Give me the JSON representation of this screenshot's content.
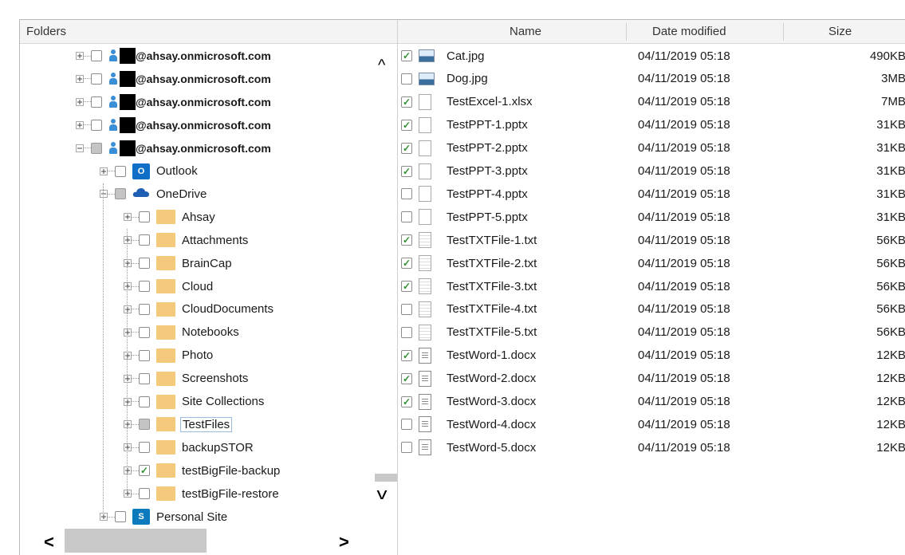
{
  "headers": {
    "folders": "Folders",
    "name": "Name",
    "date_modified": "Date modified",
    "size": "Size"
  },
  "tree": [
    {
      "label": "@ahsay.onmicrosoft.com",
      "type": "user",
      "level": 0,
      "expander": "plus",
      "check": "none"
    },
    {
      "label": "@ahsay.onmicrosoft.com",
      "type": "user",
      "level": 0,
      "expander": "plus",
      "check": "none"
    },
    {
      "label": "@ahsay.onmicrosoft.com",
      "type": "user",
      "level": 0,
      "expander": "plus",
      "check": "none"
    },
    {
      "label": "@ahsay.onmicrosoft.com",
      "type": "user",
      "level": 0,
      "expander": "plus",
      "check": "none"
    },
    {
      "label": "@ahsay.onmicrosoft.com",
      "type": "user",
      "level": 0,
      "expander": "minus",
      "check": "partial"
    },
    {
      "label": "Outlook",
      "type": "outlook",
      "level": 1,
      "expander": "plus",
      "check": "none"
    },
    {
      "label": "OneDrive",
      "type": "onedrive",
      "level": 1,
      "expander": "minus",
      "check": "partial"
    },
    {
      "label": "Ahsay",
      "type": "folder",
      "level": 2,
      "expander": "plus",
      "check": "none"
    },
    {
      "label": "Attachments",
      "type": "folder",
      "level": 2,
      "expander": "plus",
      "check": "none"
    },
    {
      "label": "BrainCap",
      "type": "folder",
      "level": 2,
      "expander": "plus",
      "check": "none"
    },
    {
      "label": "Cloud",
      "type": "folder",
      "level": 2,
      "expander": "plus",
      "check": "none"
    },
    {
      "label": "CloudDocuments",
      "type": "folder",
      "level": 2,
      "expander": "plus",
      "check": "none"
    },
    {
      "label": "Notebooks",
      "type": "folder",
      "level": 2,
      "expander": "plus",
      "check": "none"
    },
    {
      "label": "Photo",
      "type": "folder",
      "level": 2,
      "expander": "plus",
      "check": "none"
    },
    {
      "label": "Screenshots",
      "type": "folder",
      "level": 2,
      "expander": "plus",
      "check": "none"
    },
    {
      "label": "Site Collections",
      "type": "folder",
      "level": 2,
      "expander": "plus",
      "check": "none"
    },
    {
      "label": "TestFiles",
      "type": "folder",
      "level": 2,
      "expander": "plus",
      "check": "partial",
      "selected": true
    },
    {
      "label": "backupSTOR",
      "type": "folder",
      "level": 2,
      "expander": "plus",
      "check": "none"
    },
    {
      "label": "testBigFile-backup",
      "type": "folder",
      "level": 2,
      "expander": "plus",
      "check": "checked"
    },
    {
      "label": "testBigFile-restore",
      "type": "folder",
      "level": 2,
      "expander": "plus",
      "check": "none"
    },
    {
      "label": "Personal Site",
      "type": "sharepoint",
      "level": 1,
      "expander": "plus",
      "check": "none"
    }
  ],
  "icons": {
    "outlook_glyph": "O",
    "sharepoint_glyph": "S",
    "scroll_up": "^",
    "scroll_down": "v",
    "scroll_left": "<",
    "scroll_right": ">",
    "check": "✓"
  },
  "files": [
    {
      "name": "Cat.jpg",
      "date": "04/11/2019 05:18",
      "size": "490KB",
      "checked": true,
      "icon": "image"
    },
    {
      "name": "Dog.jpg",
      "date": "04/11/2019 05:18",
      "size": "3MB",
      "checked": false,
      "icon": "image"
    },
    {
      "name": "TestExcel-1.xlsx",
      "date": "04/11/2019 05:18",
      "size": "7MB",
      "checked": true,
      "icon": "doc"
    },
    {
      "name": "TestPPT-1.pptx",
      "date": "04/11/2019 05:18",
      "size": "31KB",
      "checked": true,
      "icon": "doc"
    },
    {
      "name": "TestPPT-2.pptx",
      "date": "04/11/2019 05:18",
      "size": "31KB",
      "checked": true,
      "icon": "doc"
    },
    {
      "name": "TestPPT-3.pptx",
      "date": "04/11/2019 05:18",
      "size": "31KB",
      "checked": true,
      "icon": "doc"
    },
    {
      "name": "TestPPT-4.pptx",
      "date": "04/11/2019 05:18",
      "size": "31KB",
      "checked": false,
      "icon": "doc"
    },
    {
      "name": "TestPPT-5.pptx",
      "date": "04/11/2019 05:18",
      "size": "31KB",
      "checked": false,
      "icon": "doc"
    },
    {
      "name": "TestTXTFile-1.txt",
      "date": "04/11/2019 05:18",
      "size": "56KB",
      "checked": true,
      "icon": "txt"
    },
    {
      "name": "TestTXTFile-2.txt",
      "date": "04/11/2019 05:18",
      "size": "56KB",
      "checked": true,
      "icon": "txt"
    },
    {
      "name": "TestTXTFile-3.txt",
      "date": "04/11/2019 05:18",
      "size": "56KB",
      "checked": true,
      "icon": "txt"
    },
    {
      "name": "TestTXTFile-4.txt",
      "date": "04/11/2019 05:18",
      "size": "56KB",
      "checked": false,
      "icon": "txt"
    },
    {
      "name": "TestTXTFile-5.txt",
      "date": "04/11/2019 05:18",
      "size": "56KB",
      "checked": false,
      "icon": "txt"
    },
    {
      "name": "TestWord-1.docx",
      "date": "04/11/2019 05:18",
      "size": "12KB",
      "checked": true,
      "icon": "word"
    },
    {
      "name": "TestWord-2.docx",
      "date": "04/11/2019 05:18",
      "size": "12KB",
      "checked": true,
      "icon": "word"
    },
    {
      "name": "TestWord-3.docx",
      "date": "04/11/2019 05:18",
      "size": "12KB",
      "checked": true,
      "icon": "word"
    },
    {
      "name": "TestWord-4.docx",
      "date": "04/11/2019 05:18",
      "size": "12KB",
      "checked": false,
      "icon": "word"
    },
    {
      "name": "TestWord-5.docx",
      "date": "04/11/2019 05:18",
      "size": "12KB",
      "checked": false,
      "icon": "word"
    }
  ]
}
